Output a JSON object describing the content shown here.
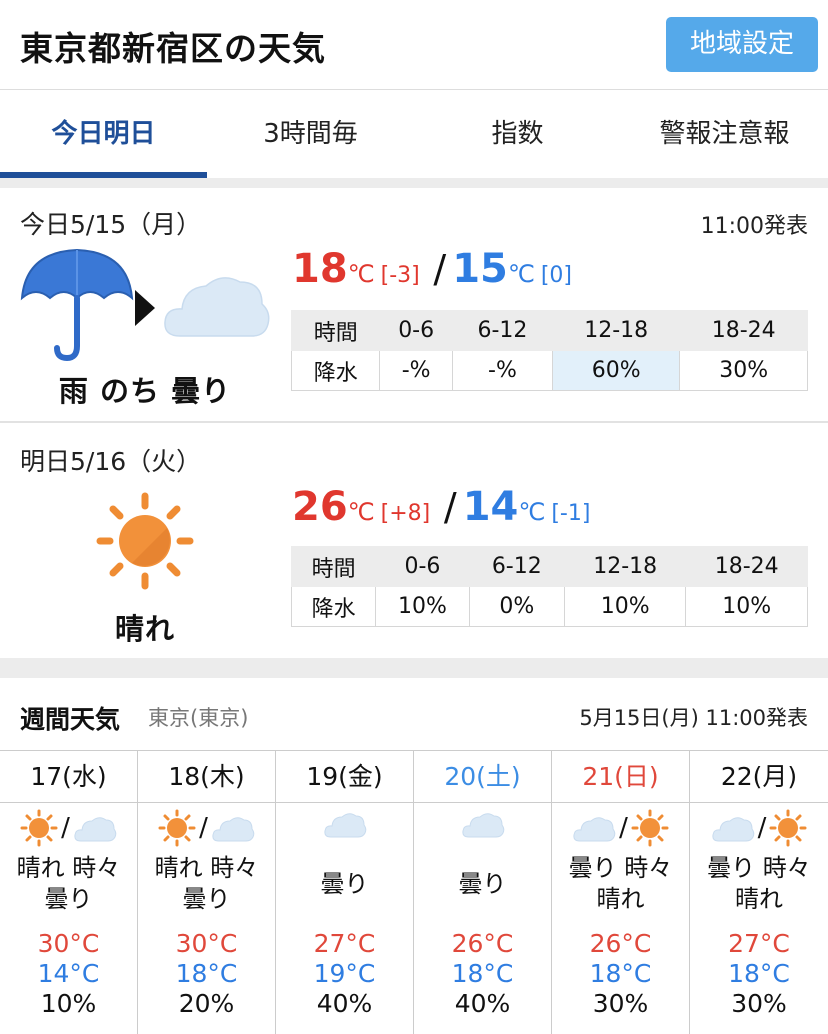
{
  "header": {
    "title": "東京都新宿区の天気",
    "region_button": "地域設定"
  },
  "tabs": [
    {
      "label": "今日明日",
      "active": true
    },
    {
      "label": "3時間毎"
    },
    {
      "label": "指数"
    },
    {
      "label": "警報注意報"
    }
  ],
  "today": {
    "date_label": "今日5/15（月）",
    "announce": "11:00発表",
    "weather_text": "雨 のち 曇り",
    "icons": [
      "umbrella-icon",
      "arrow-right-icon",
      "cloud-icon"
    ],
    "high": "18",
    "high_diff": "[-3]",
    "low": "15",
    "low_diff": "[0]",
    "unit": "℃",
    "rain": {
      "header": [
        "時間",
        "0-6",
        "6-12",
        "12-18",
        "18-24"
      ],
      "row": [
        "降水",
        "-%",
        "-%",
        "60%",
        "30%"
      ]
    }
  },
  "tomorrow": {
    "date_label": "明日5/16（火）",
    "weather_text": "晴れ",
    "icons": [
      "sun-icon"
    ],
    "high": "26",
    "high_diff": "[+8]",
    "low": "14",
    "low_diff": "[-1]",
    "unit": "℃",
    "rain": {
      "header": [
        "時間",
        "0-6",
        "6-12",
        "12-18",
        "18-24"
      ],
      "row": [
        "降水",
        "10%",
        "0%",
        "10%",
        "10%"
      ]
    }
  },
  "week": {
    "title": "週間天気",
    "area": "東京(東京)",
    "announce": "5月15日(月) 11:00発表",
    "days": [
      {
        "date": "17(水)",
        "text1": "晴れ 時々",
        "text2": "曇り",
        "hi": "30°C",
        "lo": "14°C",
        "pop": "10%",
        "icons": "sun-cloud"
      },
      {
        "date": "18(木)",
        "text1": "晴れ 時々",
        "text2": "曇り",
        "hi": "30°C",
        "lo": "18°C",
        "pop": "20%",
        "icons": "sun-cloud"
      },
      {
        "date": "19(金)",
        "text1": "曇り",
        "text2": "",
        "hi": "27°C",
        "lo": "19°C",
        "pop": "40%",
        "icons": "cloud"
      },
      {
        "date": "20(土)",
        "text1": "曇り",
        "text2": "",
        "hi": "26°C",
        "lo": "18°C",
        "pop": "40%",
        "icons": "cloud"
      },
      {
        "date": "21(日)",
        "text1": "曇り 時々",
        "text2": "晴れ",
        "hi": "26°C",
        "lo": "18°C",
        "pop": "30%",
        "icons": "cloud-sun"
      },
      {
        "date": "22(月)",
        "text1": "曇り 時々",
        "text2": "晴れ",
        "hi": "27°C",
        "lo": "18°C",
        "pop": "30%",
        "icons": "cloud-sun"
      }
    ]
  },
  "colors": {
    "accent": "#1f4f99",
    "button": "#55a9ea",
    "high": "#e0372e",
    "low": "#2f7de1",
    "saturday": "#3c8de4",
    "sunday": "#e0483b"
  }
}
